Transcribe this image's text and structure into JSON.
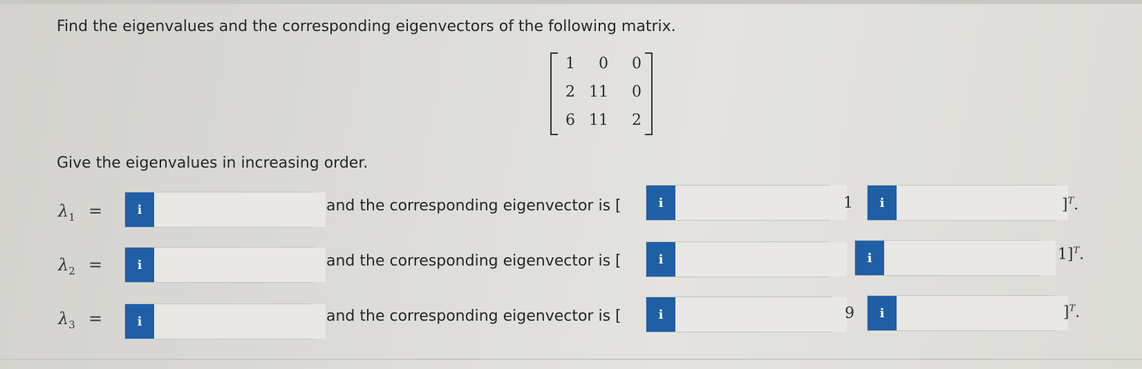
{
  "question": "Find the eigenvalues and the corresponding eigenvectors of the following matrix.",
  "matrix": [
    [
      "1",
      "0",
      "0"
    ],
    [
      "2",
      "11",
      "0"
    ],
    [
      "6",
      "11",
      "2"
    ]
  ],
  "instruction": "Give the eigenvalues in increasing order.",
  "info_icon": "i",
  "equals": "=",
  "rows": [
    {
      "lambda": "λ",
      "sub": "1",
      "lambda_value": "",
      "vector_label": "and the corresponding eigenvector is [",
      "v1": "",
      "between": "1",
      "v3": "",
      "closer": "]",
      "closer_sup": "T",
      "closer_end": "."
    },
    {
      "lambda": "λ",
      "sub": "2",
      "lambda_value": "",
      "vector_label": "and the corresponding eigenvector is [",
      "v1": "",
      "between": "",
      "v3": "",
      "closer": "1]",
      "closer_sup": "T",
      "closer_end": "."
    },
    {
      "lambda": "λ",
      "sub": "3",
      "lambda_value": "",
      "vector_label": "and the corresponding eigenvector is [",
      "v1": "",
      "between": "9",
      "v3": "",
      "closer": "]",
      "closer_sup": "T",
      "closer_end": "."
    }
  ]
}
